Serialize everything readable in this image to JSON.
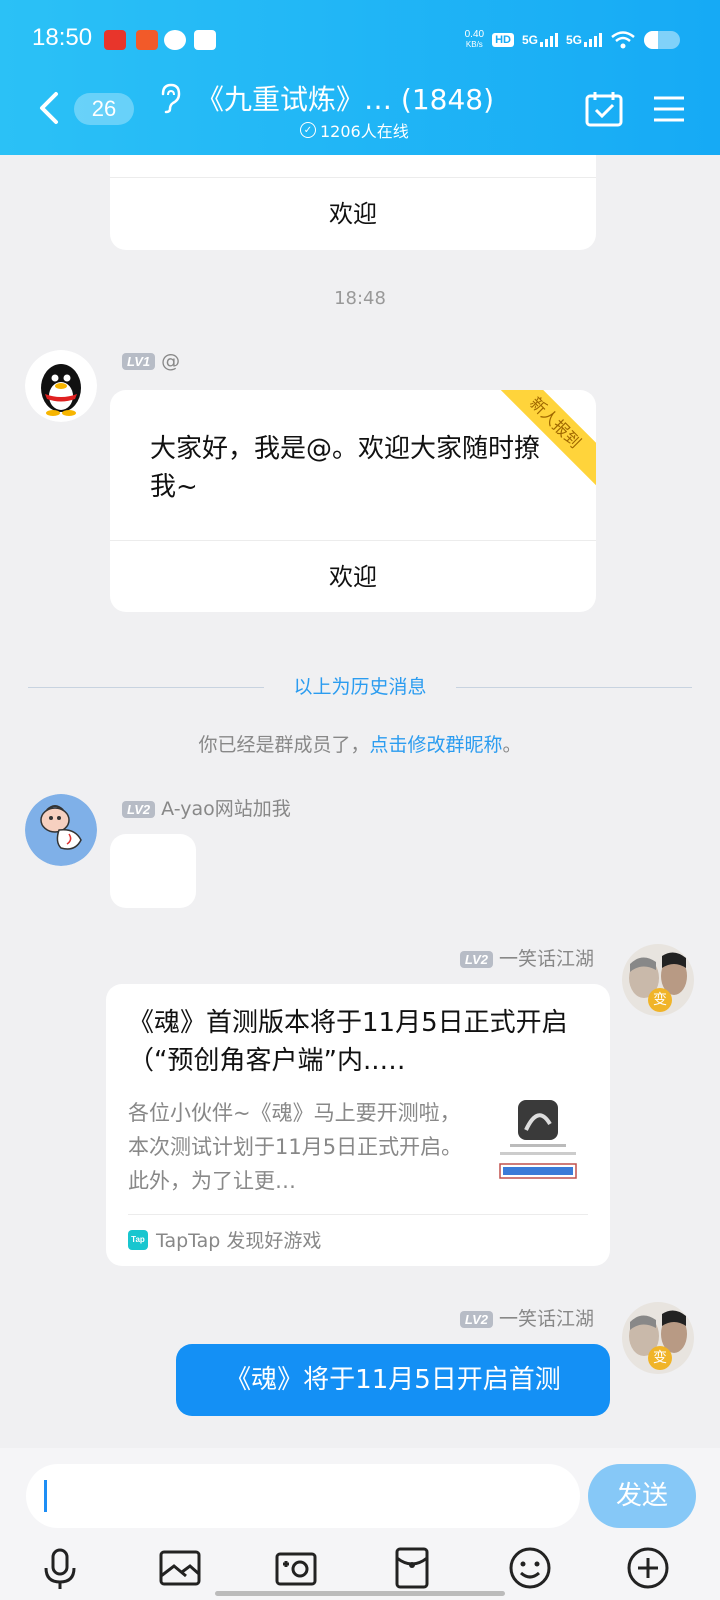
{
  "status_bar": {
    "time": "18:50",
    "net_speed_value": "0.40",
    "net_speed_unit": "KB/s",
    "hd_label": "HD",
    "sim1": "5G",
    "sim2": "5G"
  },
  "header": {
    "unread_count": "26",
    "group_title": "《九重试炼》… (1848)",
    "online_count": "1206人在线"
  },
  "messages": {
    "top_welcome": "欢迎",
    "timestamp": "18:48",
    "newcomer": {
      "level": "LV1",
      "nickname": "@",
      "ribbon": "新人报到",
      "text": "大家好，我是@。欢迎大家随时撩我~",
      "welcome": "欢迎"
    },
    "history_divider": "以上为历史消息",
    "member_notice_prefix": "你已经是群成员了，",
    "member_notice_link": "点击修改群昵称",
    "member_notice_suffix": "。",
    "ayao": {
      "level": "LV2",
      "nickname": "A-yao网站加我"
    },
    "share_msg": {
      "level": "LV2",
      "nickname": "一笑话江湖",
      "avatar_badge": "变",
      "title": "《魂》首测版本将于11月5日正式开启（“预创角客户端”内..…",
      "desc": "各位小伙伴~《魂》马上要开测啦，本次测试计划于11月5日正式开启。此外，为了让更…",
      "source": "TapTap 发现好游戏",
      "source_logo": "Tap"
    },
    "text_msg": {
      "level": "LV2",
      "nickname": "一笑话江湖",
      "avatar_badge": "变",
      "text": "《魂》将于11月5日开启首测"
    }
  },
  "input": {
    "send_label": "发送"
  },
  "colors": {
    "header_start": "#2bc1f6",
    "header_end": "#16aaf5",
    "bubble_blue": "#1490f5",
    "link_blue": "#2b9cf0",
    "send_btn": "#86c8f7"
  }
}
